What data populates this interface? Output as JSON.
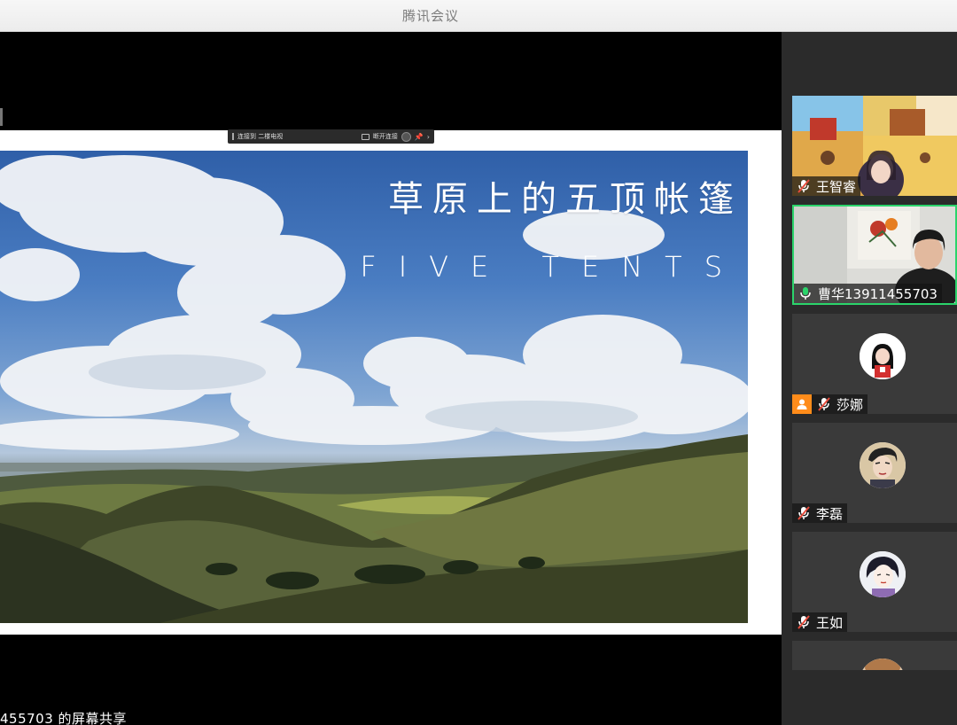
{
  "app": {
    "title": "腾讯会议"
  },
  "share_toolbar": {
    "connected_label": "连接到 二楼电视",
    "disconnect_label": "断开连接"
  },
  "slide": {
    "title": "草原上的五顶帐篷",
    "subtitle": "FIVE TENTS"
  },
  "share_label": "455703 的屏幕共享",
  "participants": [
    {
      "name": "王智睿",
      "mic": "muted"
    },
    {
      "name": "曹华13911455703",
      "mic": "on",
      "speaking": true
    },
    {
      "name": "莎娜",
      "mic": "muted",
      "host": true
    },
    {
      "name": "李磊",
      "mic": "muted"
    },
    {
      "name": "王如",
      "mic": "muted"
    }
  ],
  "colors": {
    "speaking_border": "#2bd46b",
    "mic_on": "#2bd46b",
    "host_badge": "#ff8c1a",
    "mic_off": "#ffffff"
  }
}
